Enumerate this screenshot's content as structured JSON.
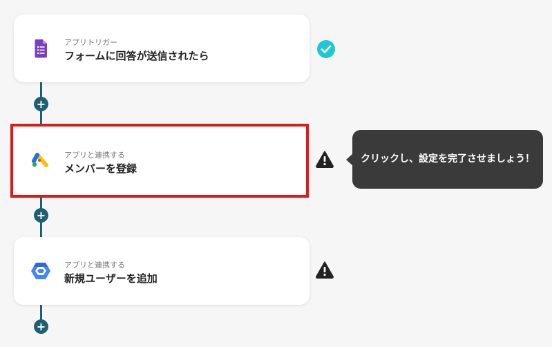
{
  "steps": [
    {
      "subtitle": "アプリトリガー",
      "title": "フォームに回答が送信されたら",
      "icon": "google-forms-icon",
      "status": "check-icon",
      "status_color": "#1fc7d6"
    },
    {
      "subtitle": "アプリと連携する",
      "title": "メンバーを登録",
      "icon": "google-ads-icon",
      "status": "warning-icon",
      "status_color": "#222222"
    },
    {
      "subtitle": "アプリと連携する",
      "title": "新規ユーザーを追加",
      "icon": "google-cloud-icon",
      "status": "warning-icon",
      "status_color": "#222222"
    }
  ],
  "add_button_symbol": "+",
  "tooltip": {
    "text": "クリックし、設定を完了させましょう！"
  },
  "colors": {
    "connector": "#1f5f72",
    "highlight": "#e01818",
    "tooltip_bg": "#3a3a3a",
    "background": "#f6f6f6"
  }
}
